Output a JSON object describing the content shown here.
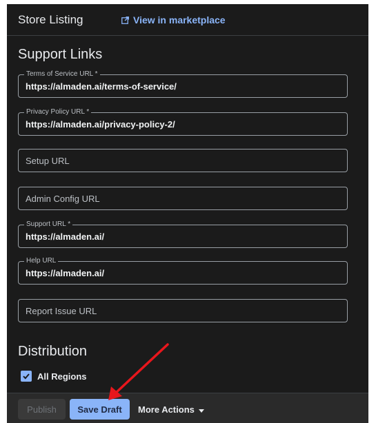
{
  "header": {
    "title": "Store Listing",
    "marketplace_link": "View in marketplace",
    "marketplace_icon": "open-in-new-icon"
  },
  "support_links": {
    "section_title": "Support Links",
    "fields": [
      {
        "name": "terms-of-service-url-field",
        "label": "Terms of Service URL *",
        "value": "https://almaden.ai/terms-of-service/"
      },
      {
        "name": "privacy-policy-url-field",
        "label": "Privacy Policy URL *",
        "value": "https://almaden.ai/privacy-policy-2/"
      },
      {
        "name": "setup-url-field",
        "placeholder": "Setup URL"
      },
      {
        "name": "admin-config-url-field",
        "placeholder": "Admin Config URL"
      },
      {
        "name": "support-url-field",
        "label": "Support URL *",
        "value": "https://almaden.ai/"
      },
      {
        "name": "help-url-field",
        "label": "Help URL",
        "value": "https://almaden.ai/"
      },
      {
        "name": "report-issue-url-field",
        "placeholder": "Report Issue URL"
      }
    ]
  },
  "distribution": {
    "section_title": "Distribution",
    "all_regions_label": "All Regions",
    "all_regions_checked": true
  },
  "footer": {
    "publish_label": "Publish",
    "save_draft_label": "Save Draft",
    "more_actions_label": "More Actions"
  },
  "colors": {
    "background": "#1b1b1b",
    "accent": "#8ab4f8",
    "annotation_arrow": "#e8161c"
  }
}
